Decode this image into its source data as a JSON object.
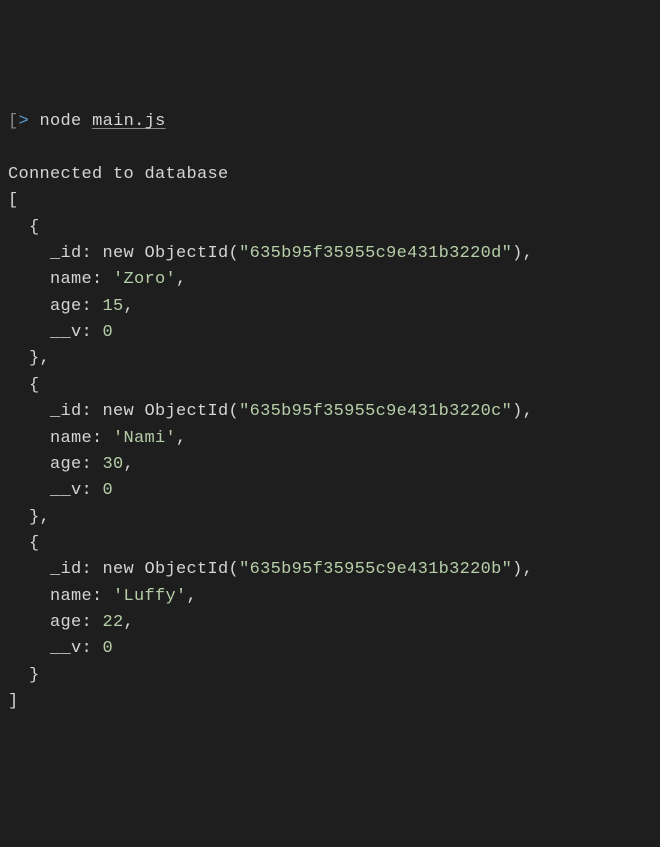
{
  "prompt": {
    "bracket_open": "[",
    "chevron": ">",
    "command": "node",
    "filename": "main.js"
  },
  "connected_msg": "Connected to database",
  "arr_open": "[",
  "arr_close": "]",
  "records": [
    {
      "open": "  {",
      "id_key": "    _id:",
      "id_new": " new",
      "id_obj": " ObjectId(",
      "id_val": "\"635b95f35955c9e431b3220d\"",
      "id_close": "),",
      "name_key": "    name:",
      "name_val": " 'Zoro'",
      "name_comma": ",",
      "age_key": "    age:",
      "age_val": " 15",
      "age_comma": ",",
      "v_key": "    __v:",
      "v_val": " 0",
      "close": "  },"
    },
    {
      "open": "  {",
      "id_key": "    _id:",
      "id_new": " new",
      "id_obj": " ObjectId(",
      "id_val": "\"635b95f35955c9e431b3220c\"",
      "id_close": "),",
      "name_key": "    name:",
      "name_val": " 'Nami'",
      "name_comma": ",",
      "age_key": "    age:",
      "age_val": " 30",
      "age_comma": ",",
      "v_key": "    __v:",
      "v_val": " 0",
      "close": "  },"
    },
    {
      "open": "  {",
      "id_key": "    _id:",
      "id_new": " new",
      "id_obj": " ObjectId(",
      "id_val": "\"635b95f35955c9e431b3220b\"",
      "id_close": "),",
      "name_key": "    name:",
      "name_val": " 'Luffy'",
      "name_comma": ",",
      "age_key": "    age:",
      "age_val": " 22",
      "age_comma": ",",
      "v_key": "    __v:",
      "v_val": " 0",
      "close": "  }"
    }
  ]
}
